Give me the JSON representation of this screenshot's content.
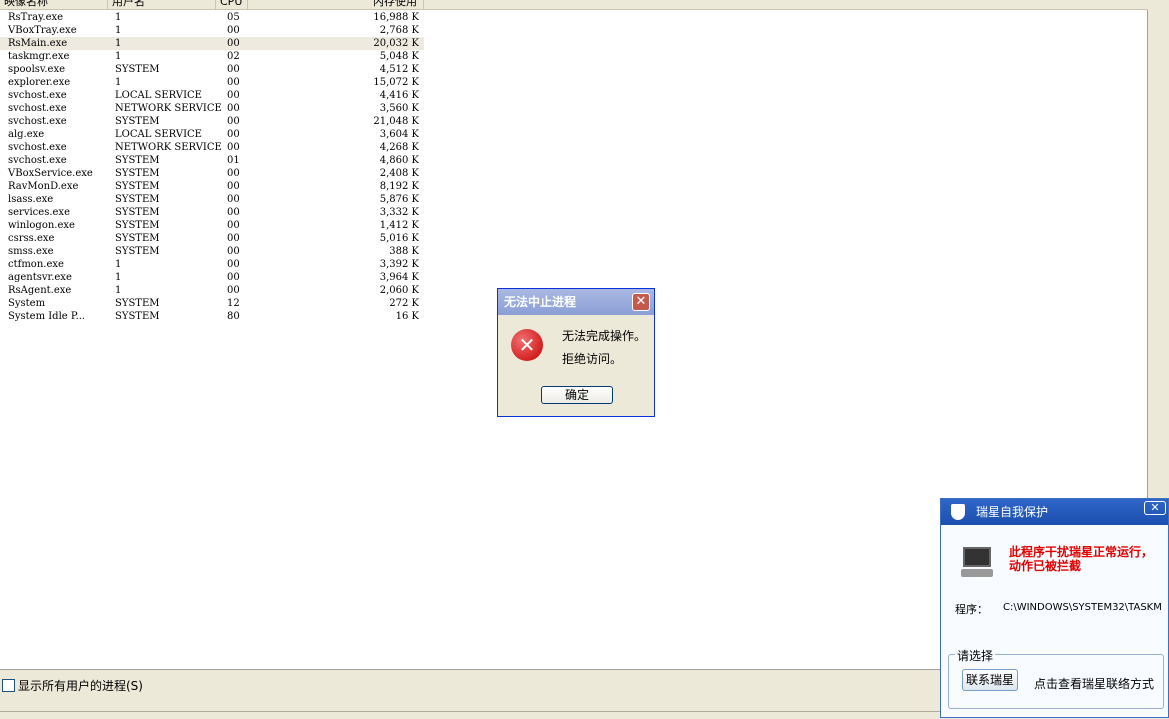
{
  "columns": [
    "映像名称",
    "用户名",
    "CPU",
    "内存使用"
  ],
  "processes": [
    {
      "name": "RsTray.exe",
      "user": "1",
      "cpu": "05",
      "mem": "16,988 K"
    },
    {
      "name": "VBoxTray.exe",
      "user": "1",
      "cpu": "00",
      "mem": "2,768 K"
    },
    {
      "name": "RsMain.exe",
      "user": "1",
      "cpu": "00",
      "mem": "20,032 K"
    },
    {
      "name": "taskmgr.exe",
      "user": "1",
      "cpu": "02",
      "mem": "5,048 K"
    },
    {
      "name": "spoolsv.exe",
      "user": "SYSTEM",
      "cpu": "00",
      "mem": "4,512 K"
    },
    {
      "name": "explorer.exe",
      "user": "1",
      "cpu": "00",
      "mem": "15,072 K"
    },
    {
      "name": "svchost.exe",
      "user": "LOCAL SERVICE",
      "cpu": "00",
      "mem": "4,416 K"
    },
    {
      "name": "svchost.exe",
      "user": "NETWORK SERVICE",
      "cpu": "00",
      "mem": "3,560 K"
    },
    {
      "name": "svchost.exe",
      "user": "SYSTEM",
      "cpu": "00",
      "mem": "21,048 K"
    },
    {
      "name": "alg.exe",
      "user": "LOCAL SERVICE",
      "cpu": "00",
      "mem": "3,604 K"
    },
    {
      "name": "svchost.exe",
      "user": "NETWORK SERVICE",
      "cpu": "00",
      "mem": "4,268 K"
    },
    {
      "name": "svchost.exe",
      "user": "SYSTEM",
      "cpu": "01",
      "mem": "4,860 K"
    },
    {
      "name": "VBoxService.exe",
      "user": "SYSTEM",
      "cpu": "00",
      "mem": "2,408 K"
    },
    {
      "name": "RavMonD.exe",
      "user": "SYSTEM",
      "cpu": "00",
      "mem": "8,192 K"
    },
    {
      "name": "lsass.exe",
      "user": "SYSTEM",
      "cpu": "00",
      "mem": "5,876 K"
    },
    {
      "name": "services.exe",
      "user": "SYSTEM",
      "cpu": "00",
      "mem": "3,332 K"
    },
    {
      "name": "winlogon.exe",
      "user": "SYSTEM",
      "cpu": "00",
      "mem": "1,412 K"
    },
    {
      "name": "csrss.exe",
      "user": "SYSTEM",
      "cpu": "00",
      "mem": "5,016 K"
    },
    {
      "name": "smss.exe",
      "user": "SYSTEM",
      "cpu": "00",
      "mem": "388 K"
    },
    {
      "name": "ctfmon.exe",
      "user": "1",
      "cpu": "00",
      "mem": "3,392 K"
    },
    {
      "name": "agentsvr.exe",
      "user": "1",
      "cpu": "00",
      "mem": "3,964 K"
    },
    {
      "name": "RsAgent.exe",
      "user": "1",
      "cpu": "00",
      "mem": "2,060 K"
    },
    {
      "name": "System",
      "user": "SYSTEM",
      "cpu": "12",
      "mem": "272 K"
    },
    {
      "name": "System Idle P...",
      "user": "SYSTEM",
      "cpu": "80",
      "mem": "16 K"
    }
  ],
  "selected_index": 2,
  "show_all_label": "显示所有用户的进程(S)",
  "error_dialog": {
    "title": "无法中止进程",
    "line1": "无法完成操作。",
    "line2": "拒绝访问。",
    "ok_label": "确定",
    "close_glyph": "✕",
    "icon_glyph": "✕"
  },
  "rising_popup": {
    "title": "瑞星自我保护",
    "close_glyph": "✕",
    "warning": "此程序干扰瑞星正常运行，动作已被拦截",
    "program_label": "程序：",
    "program_path": "C:\\WINDOWS\\SYSTEM32\\TASKM",
    "group_label": "请选择",
    "contact_button": "联系瑞星",
    "contact_hint": "点击查看瑞星联络方式"
  }
}
